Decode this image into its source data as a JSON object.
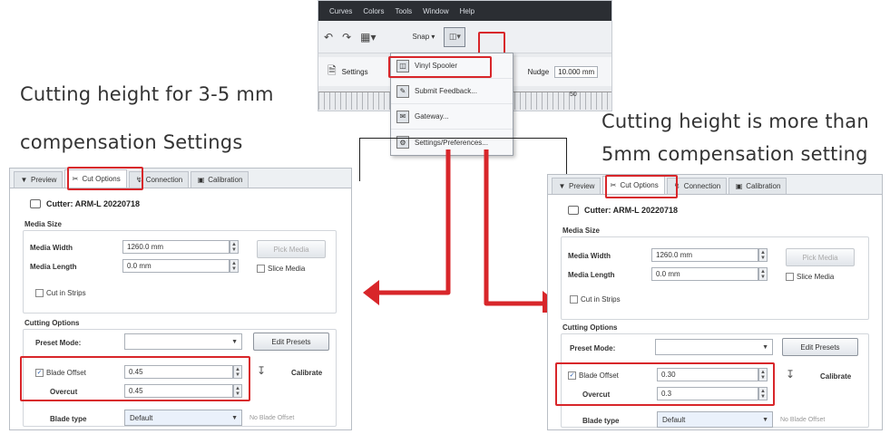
{
  "captions": {
    "left_line1": "Cutting height for 3-5 mm",
    "left_line2": "compensation Settings",
    "right_line1": "Cutting height is more than",
    "right_line2": "5mm compensation setting"
  },
  "menu_screenshot": {
    "menu_bar": [
      "Curves",
      "Colors",
      "Tools",
      "Window",
      "Help"
    ],
    "toolbar": {
      "snap_label": "Snap",
      "settings_label": "Settings",
      "nudge_label": "Nudge",
      "nudge_value": "10.000 mm",
      "ruler_label": "50"
    },
    "dropdown_items": [
      {
        "icon": "vinyl-spooler-icon",
        "label": "Vinyl Spooler"
      },
      {
        "icon": "feedback-icon",
        "label": "Submit Feedback..."
      },
      {
        "icon": "gateway-icon",
        "label": "Gateway..."
      },
      {
        "icon": "settings-icon",
        "label": "Settings/Preferences..."
      }
    ]
  },
  "panel_common": {
    "tabs": [
      "Preview",
      "Cut Options",
      "Connection",
      "Calibration"
    ],
    "cutter_label": "Cutter: ARM-L 20220718",
    "media_size_title": "Media Size",
    "media_width_label": "Media Width",
    "media_length_label": "Media Length",
    "media_width_value": "1260.0 mm",
    "media_length_value": "0.0 mm",
    "pick_media_label": "Pick Media",
    "slice_media_label": "Slice Media",
    "cut_in_strips_label": "Cut in Strips",
    "cutting_options_title": "Cutting Options",
    "preset_mode_label": "Preset Mode:",
    "edit_presets_label": "Edit Presets",
    "blade_offset_label": "Blade Offset",
    "overcut_label": "Overcut",
    "calibrate_label": "Calibrate",
    "blade_type_label": "Blade type",
    "blade_type_value": "Default",
    "no_blade_offset_label": "No Blade Offset"
  },
  "left_panel": {
    "blade_offset_value": "0.45",
    "overcut_value": "0.45"
  },
  "right_panel": {
    "blade_offset_value": "0.30",
    "overcut_value": "0.3"
  },
  "colors": {
    "highlight": "#d8262a",
    "arrow": "#d8262a"
  }
}
